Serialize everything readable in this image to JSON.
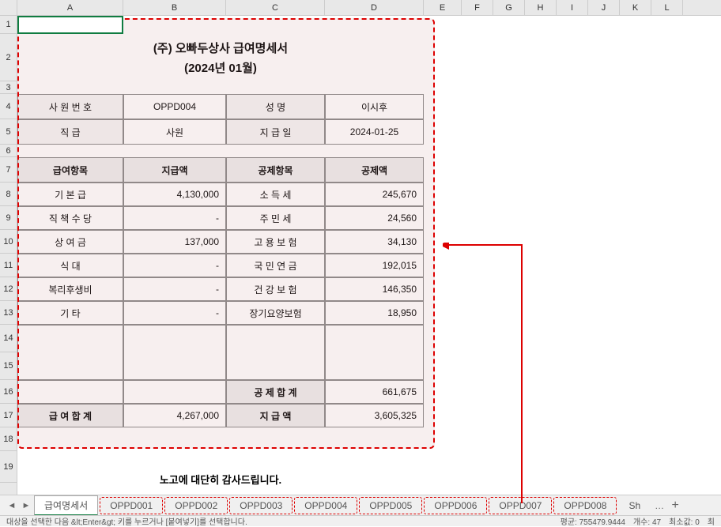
{
  "columns": [
    "A",
    "B",
    "C",
    "D",
    "E",
    "F",
    "G",
    "H",
    "I",
    "J",
    "K",
    "L"
  ],
  "rows": [
    1,
    2,
    3,
    4,
    5,
    6,
    7,
    8,
    9,
    10,
    11,
    12,
    13,
    14,
    15,
    16,
    17,
    18,
    19
  ],
  "title": {
    "line1": "(주) 오빠두상사 급여명세서",
    "line2": "(2024년 01월)"
  },
  "info": {
    "emp_no_label": "사 원 번 호",
    "emp_no": "OPPD004",
    "name_label": "성        명",
    "name": "이시후",
    "grade_label": "직        급",
    "grade": "사원",
    "date_label": "지   급   일",
    "date": "2024-01-25"
  },
  "headers": {
    "pay_item": "급여항목",
    "pay_amount": "지급액",
    "ded_item": "공제항목",
    "ded_amount": "공제액"
  },
  "rows_data": [
    {
      "pay_item": "기   본   급",
      "pay_amount": "4,130,000",
      "ded_item": "소   득   세",
      "ded_amount": "245,670"
    },
    {
      "pay_item": "직 책 수 당",
      "pay_amount": "-",
      "ded_item": "주   민   세",
      "ded_amount": "24,560"
    },
    {
      "pay_item": "상   여   금",
      "pay_amount": "137,000",
      "ded_item": "고 용 보 험",
      "ded_amount": "34,130"
    },
    {
      "pay_item": "식        대",
      "pay_amount": "-",
      "ded_item": "국 민 연 금",
      "ded_amount": "192,015"
    },
    {
      "pay_item": "복리후생비",
      "pay_amount": "-",
      "ded_item": "건 강 보 험",
      "ded_amount": "146,350"
    },
    {
      "pay_item": "기        타",
      "pay_amount": "-",
      "ded_item": "장기요양보험",
      "ded_amount": "18,950"
    }
  ],
  "totals": {
    "ded_total_label": "공 제 합 계",
    "ded_total": "661,675",
    "pay_total_label": "급 여 합 계",
    "pay_total": "4,267,000",
    "net_label": "지   급   액",
    "net": "3,605,325"
  },
  "footer_msg": "노고에 대단히 감사드립니다.",
  "tabs": {
    "main": "급여명세서",
    "items": [
      "OPPD001",
      "OPPD002",
      "OPPD003",
      "OPPD004",
      "OPPD005",
      "OPPD006",
      "OPPD007",
      "OPPD008"
    ],
    "more": "Sh",
    "ellipsis": "…"
  },
  "status": {
    "left": "대상을 선택한 다음 &lt;Enter&gt; 키를 누르거나 [붙여넣기]를 선택합니다.",
    "avg": "평균: 755479.9444",
    "count": "개수: 47",
    "min": "최소값: 0",
    "max": "최"
  }
}
